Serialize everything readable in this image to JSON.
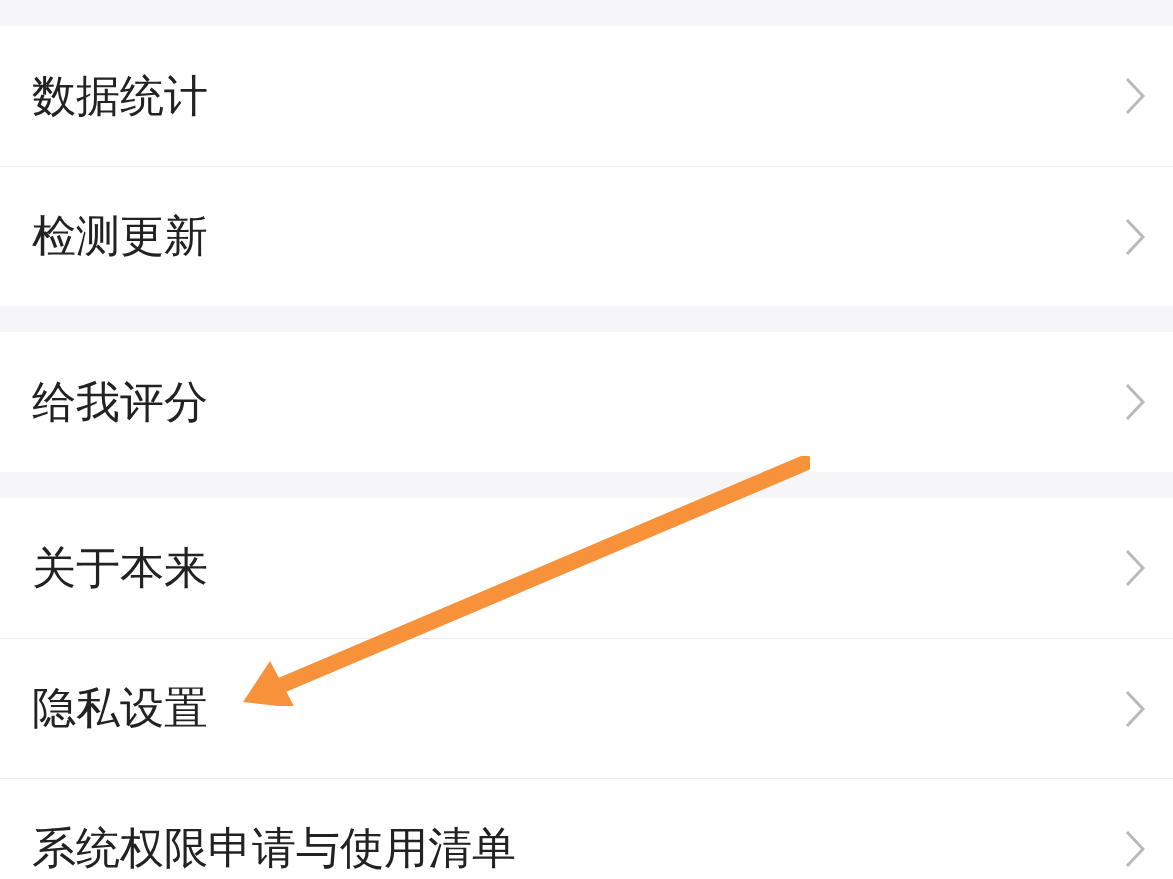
{
  "groups": [
    {
      "items": [
        {
          "label": "数据统计"
        },
        {
          "label": "检测更新"
        }
      ]
    },
    {
      "items": [
        {
          "label": "给我评分"
        }
      ]
    },
    {
      "items": [
        {
          "label": "关于本来"
        },
        {
          "label": "隐私设置"
        },
        {
          "label": "系统权限申请与使用清单"
        }
      ]
    }
  ]
}
